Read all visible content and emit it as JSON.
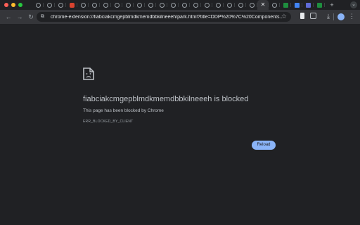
{
  "window": {
    "traffic_colors": [
      "#ff5f57",
      "#febc2e",
      "#28c840"
    ]
  },
  "tabs": [
    {
      "icon": "generic-favicon-icon"
    },
    {
      "icon": "generic-favicon-icon"
    },
    {
      "icon": "generic-favicon-icon"
    },
    {
      "icon": "red-app-favicon-icon"
    },
    {
      "icon": "generic-favicon-icon"
    },
    {
      "icon": "generic-favicon-icon"
    },
    {
      "icon": "generic-favicon-icon"
    },
    {
      "icon": "generic-favicon-icon"
    },
    {
      "icon": "generic-favicon-icon"
    },
    {
      "icon": "generic-favicon-icon"
    },
    {
      "icon": "generic-favicon-icon"
    },
    {
      "icon": "generic-favicon-icon"
    },
    {
      "icon": "generic-favicon-icon"
    },
    {
      "icon": "generic-favicon-icon"
    },
    {
      "icon": "generic-favicon-icon"
    },
    {
      "icon": "generic-favicon-icon"
    },
    {
      "icon": "generic-favicon-icon"
    },
    {
      "icon": "generic-favicon-icon"
    },
    {
      "icon": "generic-favicon-icon"
    },
    {
      "icon": "generic-favicon-icon"
    },
    {
      "icon": "close-icon",
      "active": true
    },
    {
      "icon": "generic-favicon-icon"
    },
    {
      "icon": "sheets-favicon-icon"
    },
    {
      "icon": "docs-favicon-icon"
    },
    {
      "icon": "meet-favicon-icon"
    },
    {
      "icon": "sheets-favicon-icon"
    }
  ],
  "omnibox": {
    "url": "chrome-extension://fiabciakcmgepblmdkmemdbbkilneeeh/park.html?title=DDP%20%7C%20Components..."
  },
  "error": {
    "title": "fiabciakcmgepblmdkmemdbbkilneeeh is blocked",
    "description": "This page has been blocked by Chrome",
    "code": "ERR_BLOCKED_BY_CLIENT",
    "reload_label": "Reload"
  },
  "colors": {
    "background": "#202124",
    "toolbar": "#35363a",
    "accent": "#8ab4f8"
  }
}
